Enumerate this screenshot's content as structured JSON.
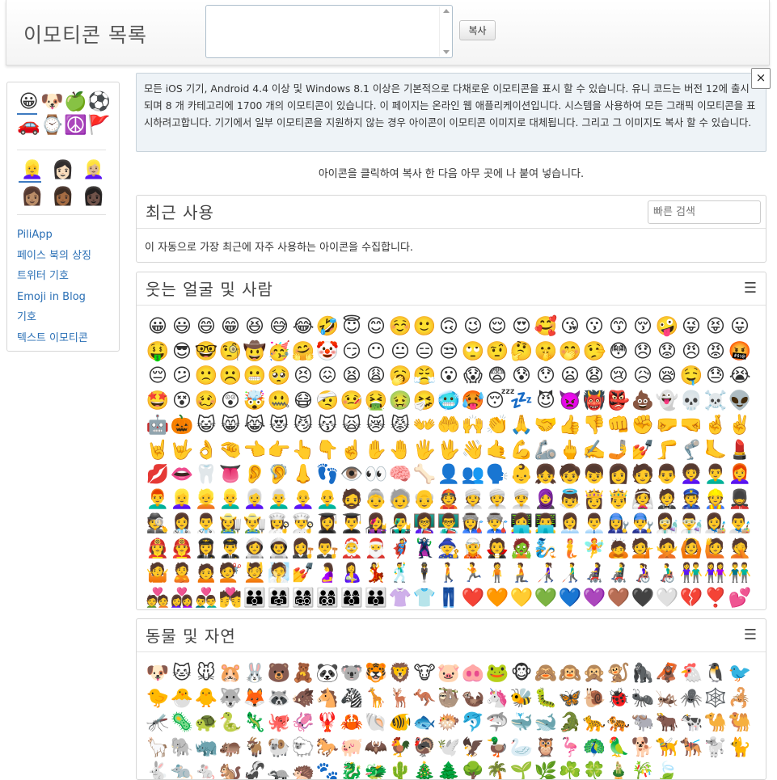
{
  "header": {
    "title": "이모티콘 목록",
    "copy_button": "복사"
  },
  "sidebar": {
    "categories": [
      "😀",
      "🐶",
      "🍏",
      "⚽",
      "🚗",
      "⌚",
      "☮️",
      "🚩"
    ],
    "skin_tones": [
      "👱‍♀️",
      "👩🏻",
      "👱🏼‍♀️",
      "👩🏽",
      "👩🏾",
      "👩🏿"
    ],
    "links": [
      "PiliApp",
      "페이스 북의 상징",
      "트위터 기호",
      "Emoji in Blog",
      "기호",
      "텍스트 이모티콘"
    ]
  },
  "info": {
    "text": "모든 iOS 기기, Android 4.4 이상 및 Windows 8.1 이상은 기본적으로 다채로운 이모티콘을 표시 할 수 있습니다. 유니 코드는 버전 12에 출시되며 8 개 카테고리에 1700 개의 이모티콘이 있습니다. 이 페이지는 온라인 웹 애플리케이션입니다. 시스템을 사용하여 모든 그래픽 이모티콘을 표시하려고합니다. 기기에서 일부 이모티콘을 지원하지 않는 경우 아이콘이 이모티콘 이미지로 대체됩니다. 그리고 그 이미지도 복사 할 수 있습니다.",
    "close": "×"
  },
  "hint": "아이콘을 클릭하여 복사 한 다음 아무 곳에 나 붙여 넣습니다.",
  "recent": {
    "title": "최근 사용",
    "search_placeholder": "빠른 검색",
    "note": "이 자동으로 가장 최근에 자주 사용하는 아이콘을 수집합니다."
  },
  "smileys": {
    "title": "웃는 얼굴 및 사람",
    "menu": "☰",
    "emojis": [
      "😀",
      "😃",
      "😄",
      "😁",
      "😆",
      "😅",
      "😂",
      "🤣",
      "😇",
      "😊",
      "☺️",
      "🙂",
      "🙃",
      "😉",
      "😌",
      "😍",
      "🥰",
      "😘",
      "😗",
      "😙",
      "😚",
      "🤪",
      "😜",
      "😝",
      "😛",
      "🤑",
      "😎",
      "🤓",
      "🧐",
      "🤠",
      "🥳",
      "🤗",
      "🤡",
      "😏",
      "😶",
      "😐",
      "😑",
      "😒",
      "🙄",
      "🤨",
      "🤔",
      "🤫",
      "🤭",
      "🤥",
      "😳",
      "😞",
      "😟",
      "😠",
      "😡",
      "🤬",
      "😔",
      "😕",
      "🙁",
      "☹️",
      "😬",
      "🥺",
      "😣",
      "😖",
      "😫",
      "😩",
      "🥱",
      "😤",
      "😮",
      "😱",
      "😨",
      "😰",
      "😯",
      "😦",
      "😧",
      "😢",
      "😥",
      "😪",
      "🤤",
      "😓",
      "😭",
      "🤩",
      "😵",
      "🥴",
      "😲",
      "🤯",
      "🤐",
      "😷",
      "🤕",
      "🤒",
      "🤮",
      "🤢",
      "🤧",
      "🥶",
      "🥵",
      "😴",
      "💤",
      "😈",
      "👿",
      "👹",
      "👺",
      "💩",
      "👻",
      "💀",
      "☠️",
      "👽",
      "🤖",
      "🎃",
      "😺",
      "😸",
      "😹",
      "😻",
      "😼",
      "😽",
      "🙀",
      "😿",
      "😾",
      "👐",
      "🤲",
      "🙌",
      "👏",
      "🙏",
      "🤝",
      "👍",
      "👎",
      "👊",
      "✊",
      "🤛",
      "🤜",
      "🤞",
      "✌️",
      "🤘",
      "🤟",
      "👌",
      "🤏",
      "👈",
      "👉",
      "👆",
      "👇",
      "☝️",
      "✋",
      "🤚",
      "🖐️",
      "🖖",
      "👋",
      "🤙",
      "💪",
      "🦾",
      "🖕",
      "✍️",
      "🤳",
      "💅",
      "🦵",
      "🦿",
      "🦶",
      "💄",
      "💋",
      "👄",
      "🦷",
      "👅",
      "👂",
      "🦻",
      "👃",
      "👣",
      "👁️",
      "👀",
      "🧠",
      "🦴",
      "👤",
      "👥",
      "🗣️",
      "👶",
      "👧",
      "🧒",
      "👦",
      "👩",
      "🧑",
      "👨",
      "👩‍🦱",
      "👨‍🦱",
      "👩‍🦰",
      "👨‍🦰",
      "👱‍♀️",
      "👱",
      "👱‍♂️",
      "👩‍🦳",
      "👨‍🦳",
      "👩‍🦲",
      "👨‍🦲",
      "🧔",
      "👵",
      "🧓",
      "👴",
      "👲",
      "👳",
      "👳‍♀️",
      "👳‍♂️",
      "🧕",
      "👼",
      "👸",
      "🤴",
      "👰",
      "🤵",
      "👮",
      "👷",
      "💂",
      "🕵️",
      "👩‍⚕️",
      "👨‍⚕️",
      "👩‍🌾",
      "👨‍🌾",
      "👩‍🍳",
      "👨‍🍳",
      "👩‍🎓",
      "👨‍🎓",
      "👩‍🎤",
      "👨‍🎤",
      "👩‍🏫",
      "👨‍🏫",
      "👩‍🏭",
      "👨‍🏭",
      "👩‍💻",
      "👨‍💻",
      "👩‍💼",
      "👨‍💼",
      "👩‍🔧",
      "👨‍🔧",
      "👩‍🔬",
      "👨‍🔬",
      "👩‍🎨",
      "👨‍🎨",
      "👩‍🚒",
      "👨‍🚒",
      "👩‍✈️",
      "👨‍✈️",
      "👩‍🚀",
      "👨‍🚀",
      "👩‍⚖️",
      "👨‍⚖️",
      "🤶",
      "🎅",
      "🦸",
      "🦹",
      "🧙",
      "🧝",
      "🧛",
      "🧟",
      "🧞",
      "🧜",
      "🧚",
      "🙇",
      "💁",
      "🙅",
      "🙆",
      "🙋",
      "🤦",
      "🤷",
      "🙎",
      "🙍",
      "💇",
      "💆",
      "🧖",
      "💅",
      "🤰",
      "🤱",
      "💃",
      "🕺",
      "🕴️",
      "🚶",
      "🏃",
      "🧍",
      "🧎",
      "👩‍🦯",
      "👨‍🦯",
      "👩‍🦼",
      "👨‍🦼",
      "👩‍🦽",
      "👨‍🦽",
      "👫",
      "👭",
      "👬",
      "💑",
      "👩‍❤️‍👩",
      "👨‍❤️‍👨",
      "💏",
      "👪",
      "👨‍👩‍👧",
      "👨‍👩‍👧‍👦",
      "👨‍👩‍👦‍👦",
      "👩‍👩‍👦",
      "👨‍👨‍👦",
      "👚",
      "👕",
      "👖",
      "❤️",
      "🧡",
      "💛",
      "💚",
      "💙",
      "💜",
      "🤎",
      "🖤",
      "🤍",
      "💔",
      "❣️",
      "💕",
      "💞",
      "💓",
      "💗",
      "💖",
      "💘",
      "💝"
    ]
  },
  "animals": {
    "title": "동물 및 자연",
    "menu": "☰",
    "emojis": [
      "🐶",
      "🐱",
      "🐭",
      "🐹",
      "🐰",
      "🐻",
      "🧸",
      "🐼",
      "🐨",
      "🐯",
      "🦁",
      "🐮",
      "🐷",
      "🐽",
      "🐸",
      "🐵",
      "🙈",
      "🙉",
      "🙊",
      "🐒",
      "🦍",
      "🦧",
      "🐔",
      "🐧",
      "🐦",
      "🐤",
      "🐣",
      "🐥",
      "🐺",
      "🦊",
      "🦝",
      "🐗",
      "🐴",
      "🦓",
      "🦒",
      "🦌",
      "🦘",
      "🦥",
      "🦦",
      "🦄",
      "🐝",
      "🐛",
      "🦋",
      "🐌",
      "🐞",
      "🐜",
      "🦗",
      "🕷️",
      "🕸️",
      "🦂",
      "🦟",
      "🦠",
      "🐢",
      "🐍",
      "🦎",
      "🐙",
      "🦑",
      "🦞",
      "🦀",
      "🐚",
      "🐠",
      "🐟",
      "🐡",
      "🐬",
      "🦈",
      "🐳",
      "🐋",
      "🐊",
      "🐆",
      "🐅",
      "🐃",
      "🐂",
      "🐄",
      "🐪",
      "🐫",
      "🦙",
      "🐘",
      "🦏",
      "🦛",
      "🐐",
      "🐏",
      "🐑",
      "🐎",
      "🐖",
      "🦇",
      "🐓",
      "🦃",
      "🕊️",
      "🦅",
      "🦆",
      "🦢",
      "🦉",
      "🦩",
      "🦚",
      "🦜",
      "🐕",
      "🦮",
      "🐕‍🦺",
      "🐩",
      "🐈",
      "🐇",
      "🐀",
      "🐁",
      "🐿️",
      "🦨",
      "🦡",
      "🦔",
      "🐾",
      "🐉",
      "🐲",
      "🌵",
      "🎄",
      "🌲",
      "🌳",
      "🌴",
      "🌱",
      "🌿",
      "☘️",
      "🍀",
      "🎍",
      "🎋",
      "🍃"
    ]
  }
}
